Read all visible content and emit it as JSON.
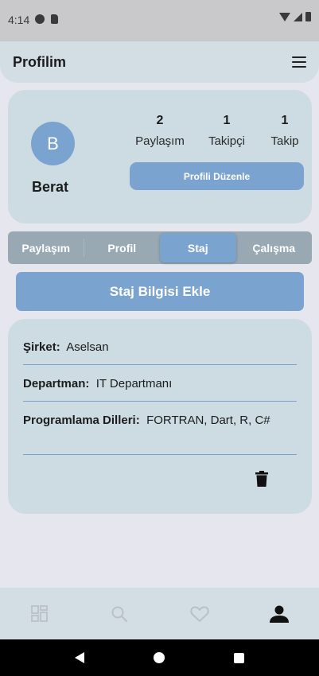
{
  "status_bar": {
    "time": "4:14"
  },
  "app_bar": {
    "title": "Profilim"
  },
  "profile": {
    "avatar_letter": "B",
    "name": "Berat",
    "stats": [
      {
        "value": "2",
        "label": "Paylaşım"
      },
      {
        "value": "1",
        "label": "Takipçi"
      },
      {
        "value": "1",
        "label": "Takip"
      }
    ],
    "edit_button": "Profili Düzenle"
  },
  "tabs": [
    {
      "label": "Paylaşım",
      "active": false
    },
    {
      "label": "Profil",
      "active": false
    },
    {
      "label": "Staj",
      "active": true
    },
    {
      "label": "Çalışma",
      "active": false
    }
  ],
  "add_button": "Staj Bilgisi Ekle",
  "internship": {
    "company_label": "Şirket:",
    "company_value": "Aselsan",
    "department_label": "Departman:",
    "department_value": "IT Departmanı",
    "languages_label": "Programlama Dilleri:",
    "languages_value": "FORTRAN, Dart, R, C#"
  },
  "bottom_nav": [
    {
      "icon": "grid-icon",
      "active": false
    },
    {
      "icon": "search-icon",
      "active": false
    },
    {
      "icon": "heart-icon",
      "active": false
    },
    {
      "icon": "person-icon",
      "active": true
    }
  ],
  "colors": {
    "accent": "#7ba3d0",
    "card": "#ccdce2",
    "tab_bar": "#99a9b3",
    "background": "#e6e6ee"
  }
}
